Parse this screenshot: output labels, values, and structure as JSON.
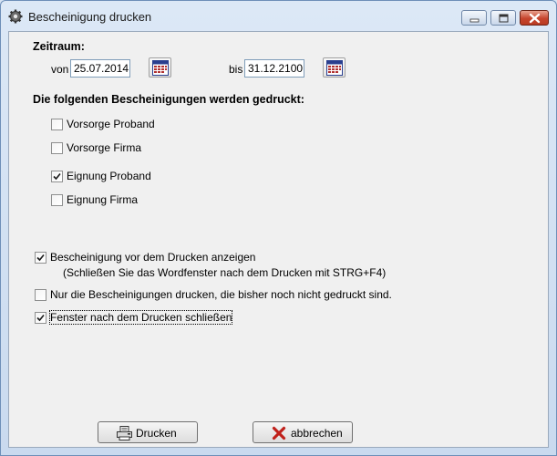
{
  "window": {
    "title": "Bescheinigung drucken",
    "controls": {
      "minimize": "minimize-icon",
      "maximize": "maximize-icon",
      "close": "close-icon"
    }
  },
  "period": {
    "heading": "Zeitraum:",
    "from_label": "von",
    "from_value": "25.07.2014",
    "to_label": "bis",
    "to_value": "31.12.2100",
    "calendar_icon": "calendar-icon"
  },
  "certificates": {
    "heading": "Die folgenden Bescheinigungen werden gedruckt:",
    "items": [
      {
        "label": "Vorsorge Proband",
        "checked": false
      },
      {
        "label": "Vorsorge Firma",
        "checked": false
      },
      {
        "label": "Eignung Proband",
        "checked": true
      },
      {
        "label": "Eignung Firma",
        "checked": false
      }
    ]
  },
  "options": {
    "preview_label": "Bescheinigung vor dem Drucken anzeigen",
    "preview_checked": true,
    "preview_hint": "(Schließen Sie das Wordfenster nach dem Drucken mit STRG+F4)",
    "only_new_label": "Nur die Bescheinigungen drucken, die bisher noch nicht gedruckt sind.",
    "only_new_checked": false,
    "close_after_label": "Fenster nach dem Drucken schließen",
    "close_after_checked": true
  },
  "buttons": {
    "print_label": "Drucken",
    "print_icon": "printer-icon",
    "cancel_label": "abbrechen",
    "cancel_icon": "red-x-icon"
  },
  "colors": {
    "title_bar": "#dce8f6",
    "client_bg": "#f0f0f0",
    "close_button": "#c6452d",
    "cancel_icon": "#c0201a"
  }
}
